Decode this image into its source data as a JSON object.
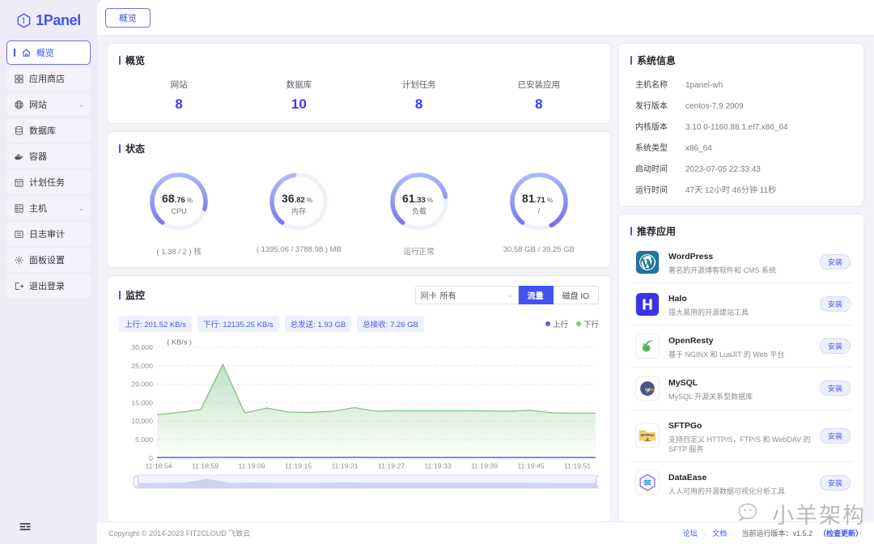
{
  "brand": {
    "name": "1Panel",
    "logo_icon": "hexagon-one-icon"
  },
  "sidebar": {
    "items": [
      {
        "label": "概览",
        "icon": "home-icon",
        "active": true,
        "caret": ""
      },
      {
        "label": "应用商店",
        "icon": "apps-grid-icon",
        "active": false,
        "caret": ""
      },
      {
        "label": "网站",
        "icon": "globe-icon",
        "active": false,
        "caret": "⌄"
      },
      {
        "label": "数据库",
        "icon": "database-icon",
        "active": false,
        "caret": ""
      },
      {
        "label": "容器",
        "icon": "docker-icon",
        "active": false,
        "caret": ""
      },
      {
        "label": "计划任务",
        "icon": "calendar-icon",
        "active": false,
        "caret": ""
      },
      {
        "label": "主机",
        "icon": "server-icon",
        "active": false,
        "caret": "⌄"
      },
      {
        "label": "日志审计",
        "icon": "log-icon",
        "active": false,
        "caret": ""
      },
      {
        "label": "面板设置",
        "icon": "gear-icon",
        "active": false,
        "caret": ""
      },
      {
        "label": "退出登录",
        "icon": "logout-icon",
        "active": false,
        "caret": ""
      }
    ],
    "collapse_icon": "collapse-menu-icon"
  },
  "tabs": [
    {
      "label": "概览",
      "active": true
    }
  ],
  "overview": {
    "title": "概览",
    "stats": [
      {
        "label": "网站",
        "value": "8"
      },
      {
        "label": "数据库",
        "value": "10"
      },
      {
        "label": "计划任务",
        "value": "8"
      },
      {
        "label": "已安装应用",
        "value": "8"
      }
    ]
  },
  "status": {
    "title": "状态",
    "gauges": [
      {
        "name": "CPU",
        "int": "68",
        "dec": ".76",
        "unit": "%",
        "percent": 68.76,
        "sub": "( 1.38 / 2 ) 核"
      },
      {
        "name": "内存",
        "int": "36",
        "dec": ".82",
        "unit": "%",
        "percent": 36.82,
        "sub": "( 1395.06 / 3788.98 ) MB"
      },
      {
        "name": "负载",
        "int": "61",
        "dec": ".33",
        "unit": "%",
        "percent": 61.33,
        "sub": "运行正常"
      },
      {
        "name": "/",
        "int": "81",
        "dec": ".71",
        "unit": "%",
        "percent": 81.71,
        "sub": "30.58 GB / 39.25 GB"
      }
    ]
  },
  "monitor": {
    "title": "监控",
    "select": {
      "prefix": "网卡",
      "value": "所有",
      "caret": "⌄"
    },
    "segments": [
      {
        "label": "流量",
        "active": true
      },
      {
        "label": "磁盘 IO",
        "active": false
      }
    ],
    "badges": [
      "上行: 201.52 KB/s",
      "下行: 12135.25 KB/s",
      "总发送: 1.93 GB",
      "总接收: 7.26 GB"
    ],
    "legend": [
      {
        "label": "上行",
        "color": "#5b5fd6"
      },
      {
        "label": "下行",
        "color": "#7cc47f"
      }
    ]
  },
  "chart_data": {
    "type": "area",
    "title": "监控",
    "unit_label": "( KB/s )",
    "xlabel": "",
    "ylabel": "KB/s",
    "ylim": [
      0,
      30000
    ],
    "yticks": [
      0,
      5000,
      10000,
      15000,
      20000,
      25000,
      30000
    ],
    "ytick_labels": [
      "0",
      "5,000",
      "10,000",
      "15,000",
      "20,000",
      "25,000",
      "30,000"
    ],
    "grid": true,
    "legend_position": "top-right",
    "xtick_labels": [
      "11:18:54",
      "11:18:59",
      "11:19:09",
      "11:19:15",
      "11:19:21",
      "11:19:27",
      "11:19:33",
      "11:19:39",
      "11:19:45",
      "11:19:51"
    ],
    "x": [
      "11:18:54",
      "11:18:57",
      "11:18:59",
      "11:19:03",
      "11:19:06",
      "11:19:09",
      "11:19:12",
      "11:19:15",
      "11:19:18",
      "11:19:21",
      "11:19:24",
      "11:19:27",
      "11:19:30",
      "11:19:33",
      "11:19:36",
      "11:19:39",
      "11:19:42",
      "11:19:45",
      "11:19:48",
      "11:19:51",
      "11:19:54"
    ],
    "series": [
      {
        "name": "下行",
        "color": "#7cc47f",
        "fill": true,
        "values": [
          11800,
          12400,
          13200,
          25400,
          12200,
          13600,
          12500,
          12400,
          12700,
          13700,
          12700,
          12900,
          12900,
          12900,
          12900,
          12800,
          12700,
          13000,
          12300,
          12200,
          12200
        ]
      },
      {
        "name": "上行",
        "color": "#5b5fd6",
        "fill": false,
        "values": [
          200,
          210,
          205,
          260,
          200,
          215,
          205,
          200,
          205,
          230,
          205,
          210,
          210,
          210,
          210,
          205,
          200,
          215,
          200,
          200,
          200
        ]
      }
    ]
  },
  "system_info": {
    "title": "系统信息",
    "rows": [
      {
        "key": "主机名称",
        "value": "1panel-wh"
      },
      {
        "key": "发行版本",
        "value": "centos-7.9.2009"
      },
      {
        "key": "内核版本",
        "value": "3.10.0-1160.88.1.el7.x86_64"
      },
      {
        "key": "系统类型",
        "value": "x86_64"
      },
      {
        "key": "启动时间",
        "value": "2023-07-05 22:33:43"
      },
      {
        "key": "运行时间",
        "value": "47天 12小时 46分钟 11秒"
      }
    ]
  },
  "recommended": {
    "title": "推荐应用",
    "install_label": "安装",
    "apps": [
      {
        "name": "WordPress",
        "desc": "著名的开源博客软件和 CMS 系统",
        "icon": "wordpress-icon"
      },
      {
        "name": "Halo",
        "desc": "强大易用的开源建站工具",
        "icon": "halo-icon"
      },
      {
        "name": "OpenResty",
        "desc": "基于 NGINX 和 LuaJIT 的 Web 平台",
        "icon": "openresty-icon"
      },
      {
        "name": "MySQL",
        "desc": "MySQL 开源关系型数据库",
        "icon": "mysql-icon"
      },
      {
        "name": "SFTPGo",
        "desc": "支持自定义 HTTP/S，FTP/S 和 WebDAV 的 SFTP 服务",
        "icon": "sftpgo-icon"
      },
      {
        "name": "DataEase",
        "desc": "人人可用的开源数据可视化分析工具",
        "icon": "dataease-icon"
      }
    ]
  },
  "footer": {
    "copyright": "Copyright © 2014-2023 FIT2CLOUD 飞致云",
    "forum": "论坛",
    "docs": "文档",
    "version_label": "当前运行版本：v1.5.2",
    "update_label": "（检查更新）"
  },
  "watermark": {
    "text": "小羊架构",
    "icon": "wechat-icon"
  },
  "colors": {
    "accent": "#4154f1",
    "gauge_start": "#b9c9f7",
    "gauge_end": "#6a5cf0",
    "chart_up": "#5b5fd6",
    "chart_down": "#7cc47f"
  }
}
